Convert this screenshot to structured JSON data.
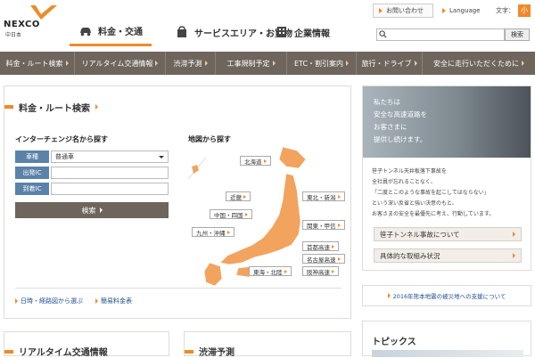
{
  "header": {
    "logo": {
      "brand": "NEXCO",
      "sub": "中日本"
    },
    "tabs": [
      {
        "label": "料金・交通",
        "active": true,
        "icon": "car-icon"
      },
      {
        "label": "サービスエリア・お買物",
        "active": false,
        "icon": "shopping-bag-icon"
      },
      {
        "label": "企業情報",
        "active": false,
        "icon": "building-icon"
      }
    ],
    "contact_label": "お問い合わせ",
    "language_label": "Language",
    "font_size_label": "文字：",
    "font_small_label": "小",
    "search": {
      "placeholder": "",
      "button_label": "検索"
    }
  },
  "nav": [
    "料金・ルート検索",
    "リアルタイム交通情報",
    "渋滞予測",
    "工事規制予定",
    "ETC・割引案内",
    "旅行・ドライブ",
    "安全に走行いただくために"
  ],
  "route_search": {
    "title": "料金・ルート検索",
    "ic_heading": "インターチェンジ名から探す",
    "fields": [
      {
        "label": "車種",
        "value": "普通車",
        "type": "select"
      },
      {
        "label": "出発IC",
        "value": "",
        "type": "text"
      },
      {
        "label": "到着IC",
        "value": "",
        "type": "text"
      }
    ],
    "search_button": "検索",
    "map_heading": "地図から探す",
    "regions": [
      "北海道",
      "東北・新潟",
      "近畿",
      "中国・四国",
      "関東・甲信",
      "九州・沖縄",
      "首都高速",
      "名古屋高速",
      "阪神高速",
      "東海・北陸"
    ],
    "links": [
      "日時・経路図から選ぶ",
      "簡易料金表"
    ]
  },
  "right": {
    "photo_lines": [
      "私たちは",
      "安全な高速道路を",
      "お客さまに",
      "提供し続けます。"
    ],
    "text_lines": [
      "笹子トンネル天井板落下事故を",
      "全社員が忘れることなく、",
      "「二度とこのような事故を起こしてはならない」",
      "という深い反省と強い決意のもと、",
      "お客さまの安全を最優先に考え、行動しています。"
    ],
    "buttons": [
      "笹子トンネル事故について",
      "具体的な取組み状況"
    ],
    "support_link": "2016年熊本地震の被災地への支援について"
  },
  "bottom": {
    "cards": [
      "リアルタイム交通情報",
      "渋滞予測"
    ],
    "topics_title": "トピックス"
  },
  "colors": {
    "accent": "#ef8a2a",
    "nav_bg": "#6e655d",
    "form_label": "#5b82a8",
    "map_fill": "#f2a35e"
  }
}
